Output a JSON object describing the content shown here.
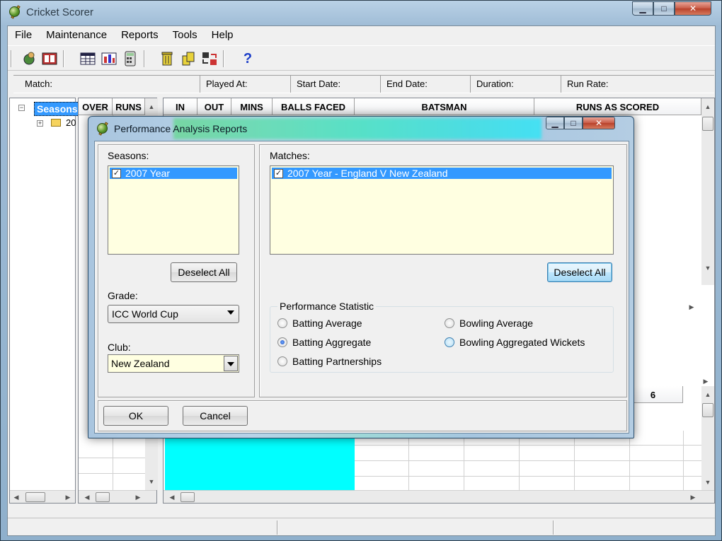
{
  "window": {
    "title": "Cricket Scorer",
    "buttons": {
      "minimize": "▁",
      "maximize": "□",
      "close": "✕"
    }
  },
  "menu": [
    {
      "label": "File"
    },
    {
      "label": "Maintenance"
    },
    {
      "label": "Reports"
    },
    {
      "label": "Tools"
    },
    {
      "label": "Help"
    }
  ],
  "toolbar": {
    "icons": [
      "globe-player-icon",
      "scoreboard-icon",
      "table-icon",
      "chart-icon",
      "calculator-icon",
      "bin-icon",
      "bins-icon",
      "transfer-icon",
      "help-icon"
    ],
    "help_label": "?"
  },
  "infobar": {
    "match_label": "Match:",
    "played_at_label": "Played At:",
    "start_date_label": "Start Date:",
    "end_date_label": "End Date:",
    "duration_label": "Duration:",
    "run_rate_label": "Run Rate:"
  },
  "tree": {
    "root_label": "Seasons",
    "child_label": "20"
  },
  "over_grid": {
    "headers": [
      "OVER",
      "RUNS"
    ]
  },
  "batting_grid": {
    "headers": [
      "IN",
      "OUT",
      "MINS",
      "BALLS FACED",
      "BATSMAN",
      "RUNS AS SCORED"
    ]
  },
  "bowling_grid": {
    "visible_header": "6"
  },
  "dialog": {
    "title": "Performance Analysis Reports",
    "seasons_label": "Seasons:",
    "seasons": [
      {
        "label": "2007 Year",
        "checked": true
      }
    ],
    "seasons_deselect": "Deselect All",
    "grade_label": "Grade:",
    "grade_value": "ICC World Cup",
    "club_label": "Club:",
    "club_value": "New Zealand",
    "matches_label": "Matches:",
    "matches": [
      {
        "label": "2007 Year - England V New Zealand",
        "checked": true
      }
    ],
    "matches_deselect": "Deselect All",
    "stat_group_label": "Performance Statistic",
    "stats": {
      "batting_average": "Batting Average",
      "batting_aggregate": "Batting Aggregate",
      "batting_partnerships": "Batting Partnerships",
      "bowling_average": "Bowling Average",
      "bowling_aggregated_wickets": "Bowling Aggregated Wickets"
    },
    "selected_stat": "batting_aggregate",
    "ok": "OK",
    "cancel": "Cancel"
  },
  "colors": {
    "selection": "#3399ff",
    "list_background": "#ffffe1",
    "highlight_cell": "#00ffff"
  }
}
